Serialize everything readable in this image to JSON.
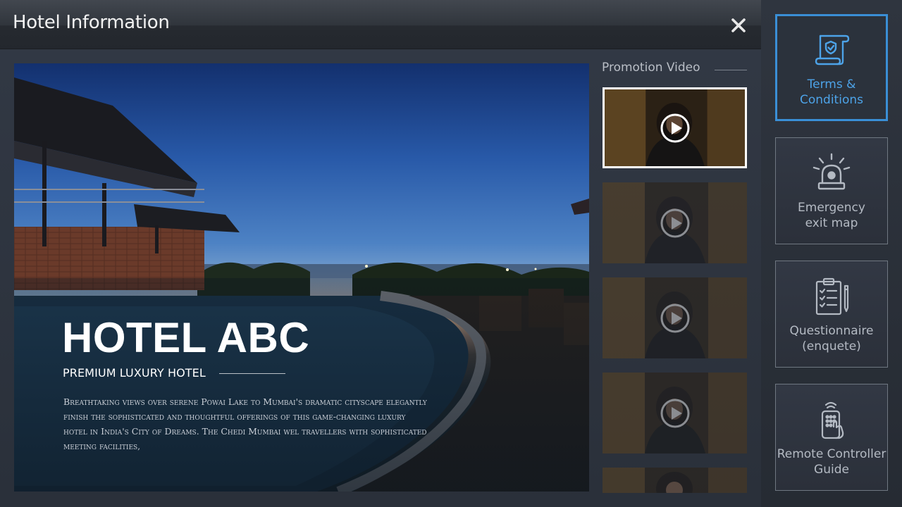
{
  "header": {
    "title": "Hotel Information",
    "close_label": "×"
  },
  "hero": {
    "name": "HOTEL ABC",
    "tagline": "PREMIUM LUXURY HOTEL",
    "description": "Breathtaking views over serene Powai Lake to Mumbai's dramatic cityscape elegantly finish the sophisticated and thoughtful offerings of this game-changing luxury hotel in India's City of Dreams. The Chedi Mumbai wel travellers with sophisticated meeting facilities,"
  },
  "promo": {
    "title": "Promotion Video",
    "videos": [
      {
        "selected": true
      },
      {
        "selected": false
      },
      {
        "selected": false
      },
      {
        "selected": false
      },
      {
        "selected": false
      }
    ]
  },
  "sidebar": {
    "items": [
      {
        "label": "Terms &\nConditions",
        "icon": "terms-document-icon",
        "active": true
      },
      {
        "label": "Emergency\nexit map",
        "icon": "emergency-siren-icon",
        "active": false
      },
      {
        "label": "Questionnaire\n(enquete)",
        "icon": "clipboard-checklist-icon",
        "active": false
      },
      {
        "label": "Remote Controller\nGuide",
        "icon": "remote-control-icon",
        "active": false
      }
    ]
  },
  "colors": {
    "accent": "#3a8fd6",
    "accent_text": "#4da3e8",
    "header_bg": "#30353c",
    "panel_bg": "#2b313a"
  }
}
